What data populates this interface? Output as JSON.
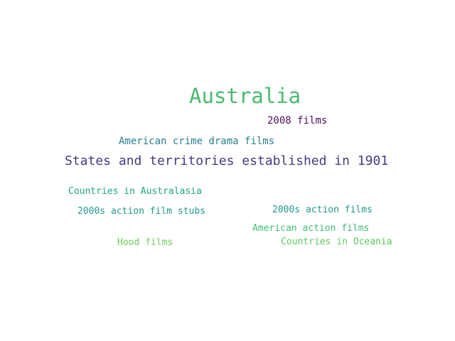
{
  "words": [
    {
      "text": "Australia",
      "color": "#4cba6e"
    },
    {
      "text": "2008 films",
      "color": "#4a0f5e"
    },
    {
      "text": "American crime drama films",
      "color": "#2a7f8e"
    },
    {
      "text": "States and territories established in 1901",
      "color": "#443b83"
    },
    {
      "text": "Countries in Australasia",
      "color": "#21a386"
    },
    {
      "text": "2000s action film stubs",
      "color": "#1f9a8a"
    },
    {
      "text": "2000s action films",
      "color": "#21988c"
    },
    {
      "text": "American action films",
      "color": "#3fbc73"
    },
    {
      "text": "Countries in Oceania",
      "color": "#5ec962"
    },
    {
      "text": "Hood films",
      "color": "#6ccd5a"
    }
  ]
}
